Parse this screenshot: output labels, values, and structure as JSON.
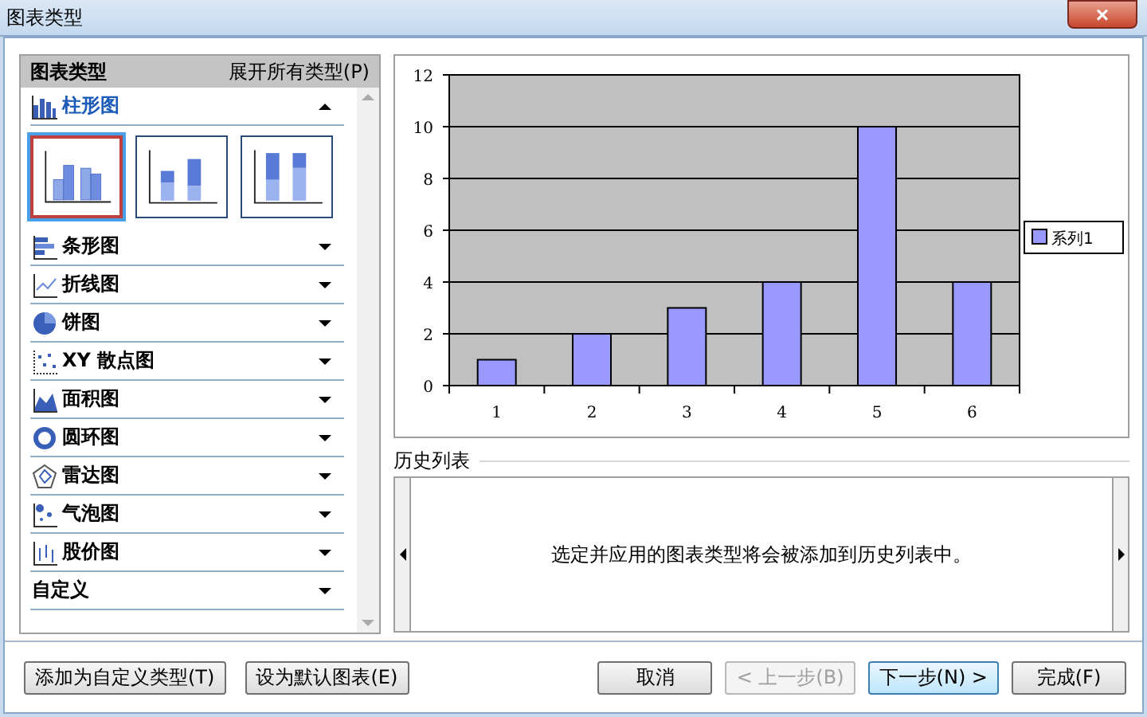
{
  "window": {
    "title": "图表类型",
    "close": "×"
  },
  "type_panel": {
    "title": "图表类型",
    "expand_all": "展开所有类型(P)",
    "types": [
      {
        "kind": "column",
        "label": "柱形图",
        "expanded": true,
        "subtypes": [
          {
            "kind": "clustered",
            "selected": true
          },
          {
            "kind": "stacked",
            "selected": false
          },
          {
            "kind": "percent",
            "selected": false
          }
        ]
      },
      {
        "kind": "bar",
        "label": "条形图",
        "expanded": false
      },
      {
        "kind": "line",
        "label": "折线图",
        "expanded": false
      },
      {
        "kind": "pie",
        "label": "饼图",
        "expanded": false
      },
      {
        "kind": "scatter",
        "label": "XY 散点图",
        "expanded": false
      },
      {
        "kind": "area",
        "label": "面积图",
        "expanded": false
      },
      {
        "kind": "doughnut",
        "label": "圆环图",
        "expanded": false
      },
      {
        "kind": "radar",
        "label": "雷达图",
        "expanded": false
      },
      {
        "kind": "bubble",
        "label": "气泡图",
        "expanded": false
      },
      {
        "kind": "stock",
        "label": "股价图",
        "expanded": false
      },
      {
        "kind": "custom",
        "label": "自定义",
        "expanded": false
      }
    ]
  },
  "preview": {
    "chart_data": {
      "type": "bar",
      "categories": [
        "1",
        "2",
        "3",
        "4",
        "5",
        "6"
      ],
      "series": [
        {
          "name": "系列1",
          "color": "#9999ff",
          "values": [
            1,
            2,
            3,
            4,
            10,
            4
          ]
        }
      ],
      "ylim": [
        0,
        12
      ],
      "yticks": [
        0,
        2,
        4,
        6,
        8,
        10,
        12
      ],
      "grid": true
    }
  },
  "history": {
    "title": "历史列表",
    "message": "选定并应用的图表类型将会被添加到历史列表中。"
  },
  "footer": {
    "left_buttons": [
      {
        "label": "添加为自定义类型(T)",
        "disabled": false,
        "default": false
      },
      {
        "label": "设为默认图表(E)",
        "disabled": false,
        "default": false
      }
    ],
    "right_buttons": [
      {
        "label": "取消",
        "disabled": false,
        "default": false
      },
      {
        "label": "< 上一步(B)",
        "disabled": true,
        "default": false
      },
      {
        "label": "下一步(N) >",
        "disabled": false,
        "default": true
      },
      {
        "label": "完成(F)",
        "disabled": false,
        "default": false
      }
    ]
  }
}
